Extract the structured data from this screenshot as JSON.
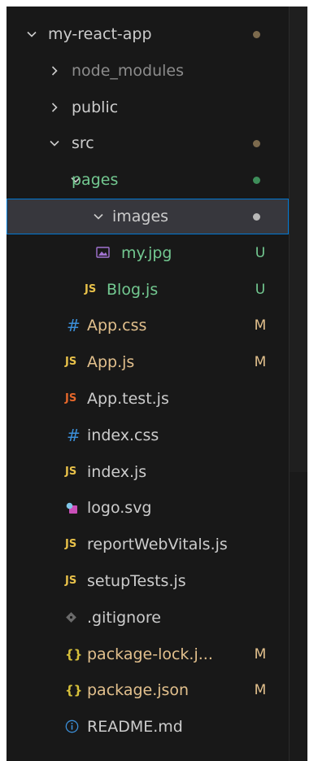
{
  "colors": {
    "sidebar_bg": "#181818",
    "selection_bg": "#37373d",
    "focus_border": "#0078d4",
    "text": "#cccccc",
    "ignored_text": "#8c8c8c",
    "untracked_green": "#73c991",
    "modified_yellow": "#e2c08d",
    "dot_brown": "#7c6a4d",
    "dot_green": "#3e8e5a",
    "js_icon": "#e8c14a",
    "test_js_icon": "#e5672b",
    "css_icon": "#3b8ed7",
    "json_icon": "#d7c13b",
    "svg_icon": "#c94fb8",
    "info_icon": "#3b8ed7"
  },
  "tree": [
    {
      "label": "my-react-app",
      "kind": "folder",
      "expanded": true,
      "decoration": "dot",
      "dot_color": "brown"
    },
    {
      "label": "node_modules",
      "kind": "folder",
      "expanded": false,
      "decoration": "none",
      "ignored": true
    },
    {
      "label": "public",
      "kind": "folder",
      "expanded": false,
      "decoration": "none"
    },
    {
      "label": "src",
      "kind": "folder",
      "expanded": true,
      "decoration": "dot",
      "dot_color": "brown"
    },
    {
      "label": "pages",
      "kind": "folder",
      "expanded": true,
      "decoration": "dot",
      "dot_color": "green"
    },
    {
      "label": "images",
      "kind": "folder",
      "expanded": true,
      "decoration": "dot",
      "dot_color": "grey",
      "selected": true
    },
    {
      "label": "my.jpg",
      "kind": "file",
      "icon": "image-icon",
      "status": "U"
    },
    {
      "label": "Blog.js",
      "kind": "file",
      "icon": "js-icon",
      "icon_text": "JS",
      "status": "U"
    },
    {
      "label": "App.css",
      "kind": "file",
      "icon": "css-icon",
      "icon_text": "#",
      "status": "M"
    },
    {
      "label": "App.js",
      "kind": "file",
      "icon": "js-icon",
      "icon_text": "JS",
      "status": "M"
    },
    {
      "label": "App.test.js",
      "kind": "file",
      "icon": "test-js-icon",
      "icon_text": "JS",
      "status": ""
    },
    {
      "label": "index.css",
      "kind": "file",
      "icon": "css-icon",
      "icon_text": "#",
      "status": ""
    },
    {
      "label": "index.js",
      "kind": "file",
      "icon": "js-icon",
      "icon_text": "JS",
      "status": ""
    },
    {
      "label": "logo.svg",
      "kind": "file",
      "icon": "svg-icon",
      "status": ""
    },
    {
      "label": "reportWebVitals.js",
      "kind": "file",
      "icon": "js-icon",
      "icon_text": "JS",
      "status": ""
    },
    {
      "label": "setupTests.js",
      "kind": "file",
      "icon": "js-icon",
      "icon_text": "JS",
      "status": ""
    },
    {
      "label": ".gitignore",
      "kind": "file",
      "icon": "gitignore-icon",
      "status": ""
    },
    {
      "label": "package-lock.j...",
      "kind": "file",
      "icon": "json-icon",
      "icon_text": "{}",
      "status": "M"
    },
    {
      "label": "package.json",
      "kind": "file",
      "icon": "json-icon",
      "icon_text": "{}",
      "status": "M"
    },
    {
      "label": "README.md",
      "kind": "file",
      "icon": "info-icon",
      "status": ""
    }
  ]
}
